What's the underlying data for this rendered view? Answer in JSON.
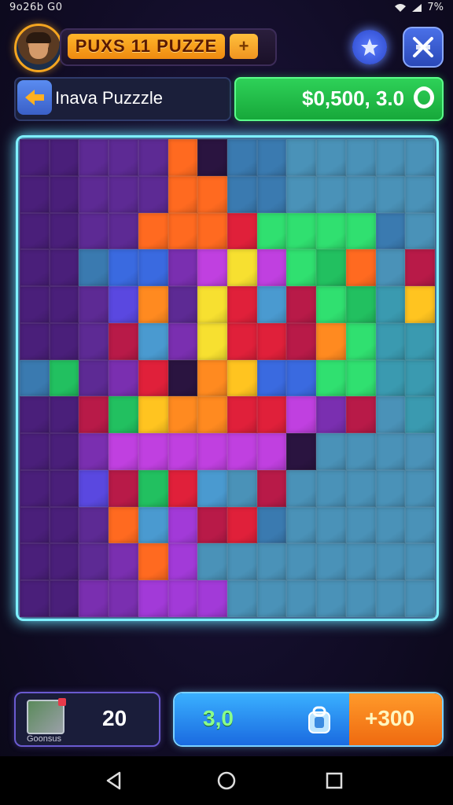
{
  "status": {
    "left": "9o26b  G0",
    "battery": "7%"
  },
  "header": {
    "title": "PUXS  11 PUZZE",
    "plus": "+"
  },
  "level": {
    "name": "Inava Puzzzle"
  },
  "score": {
    "value": "$0,500, 3.0"
  },
  "board": {
    "cols": 14,
    "rows": 13,
    "palette": {
      "v": "#4a1f7a",
      "V": "#5d2a94",
      "m": "#7a2fb0",
      "p": "#a23ad8",
      "P": "#c040e0",
      "t": "#3a7ab0",
      "T": "#4a92b8",
      "c": "#3a9ab0",
      "o": "#ff8a20",
      "O": "#ff6a20",
      "y": "#f7e030",
      "Y": "#ffc420",
      "r": "#e0203a",
      "R": "#b81a48",
      "g": "#22c060",
      "G": "#30e070",
      "b": "#3a6ae0",
      "B": "#5a48e0",
      "k": "#2a1440",
      "s": "#4a9ad0"
    },
    "grid": [
      "vvVVVOkttTTTTT",
      "vvVVVOOttTTTTT",
      "vvVVOOOrGGGGtT",
      "vvtbbmPyPGgOTR",
      "vvVBoVyrsRGgcY",
      "vvVRsmyrrRoGcc",
      "tgVmrkoYbbGGcc",
      "vvRgYoorrPmRTc",
      "vvmPPPPPPkTTTT",
      "vvBRgrsTRTTTTT",
      "vvVOspRrtTTTTT",
      "vvVmOpTTTTTTTT",
      "vvmmpppTTTTTTT"
    ]
  },
  "footer": {
    "pieces_count": "20",
    "pieces_label": "Goonsus",
    "action_value": "3,0",
    "bonus": "+300"
  }
}
